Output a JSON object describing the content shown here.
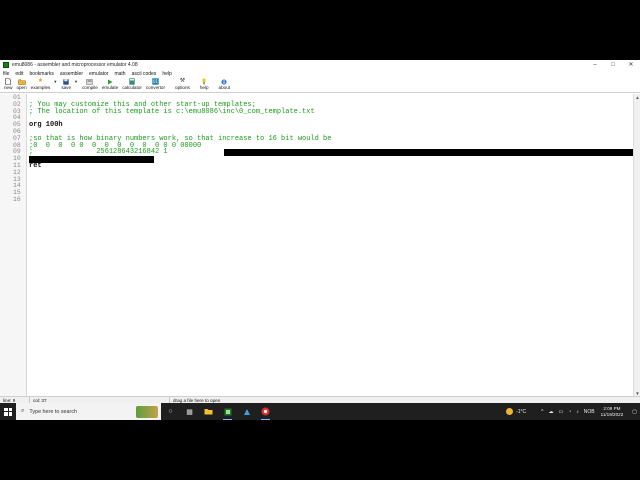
{
  "window": {
    "title": "emu8086 - assembler and microprocessor emulator 4.08",
    "controls": [
      "–",
      "□",
      "✕"
    ]
  },
  "menu": [
    "file",
    "edit",
    "bookmarks",
    "assembler",
    "emulator",
    "math",
    "ascii codes",
    "help"
  ],
  "toolbar": [
    {
      "label": "new",
      "icon": "new-file-icon"
    },
    {
      "label": "open",
      "icon": "open-folder-icon"
    },
    {
      "label": "examples",
      "icon": "examples-star-icon"
    },
    {
      "label": "save",
      "icon": "save-disk-icon"
    },
    {
      "label": "compile",
      "icon": "compile-icon"
    },
    {
      "label": "emulate",
      "icon": "emulate-play-icon"
    },
    {
      "label": "calculator",
      "icon": "calculator-icon"
    },
    {
      "label": "convertor",
      "icon": "convertor-icon"
    },
    {
      "label": "options",
      "icon": "options-tools-icon"
    },
    {
      "label": "help",
      "icon": "help-icon"
    },
    {
      "label": "about",
      "icon": "about-icon"
    }
  ],
  "editor": {
    "line_numbers": [
      "01",
      "02",
      "03",
      "04",
      "05",
      "06",
      "07",
      "08",
      "09",
      "10",
      "11",
      "12",
      "13",
      "14",
      "15",
      "16"
    ],
    "lines": [
      "",
      "; You may customize this and other start-up templates;",
      "; The location of this template is c:\\emu8086\\inc\\0_com_template.txt",
      "",
      "org 100h",
      "",
      ";so that is how binary numbers work, so that increase to 16 bit would be",
      ";0  0  0  0 0  0  0  0  0  0  0 0 0 00000",
      ";               256128643216842 1",
      "",
      "ret",
      "",
      "",
      "",
      "",
      ""
    ]
  },
  "statusbar": {
    "line": "line: 9",
    "col": "col: 37",
    "hint": "drag a file here to open"
  },
  "taskbar": {
    "search_placeholder": "Type here to search",
    "weather": "-1°C",
    "lang": "NOB",
    "time": "2:09 PM",
    "date": "11/19/2022"
  },
  "colors": {
    "comment": "#1a9c1a",
    "code": "#111111",
    "taskbar": "#1f1f1f"
  }
}
